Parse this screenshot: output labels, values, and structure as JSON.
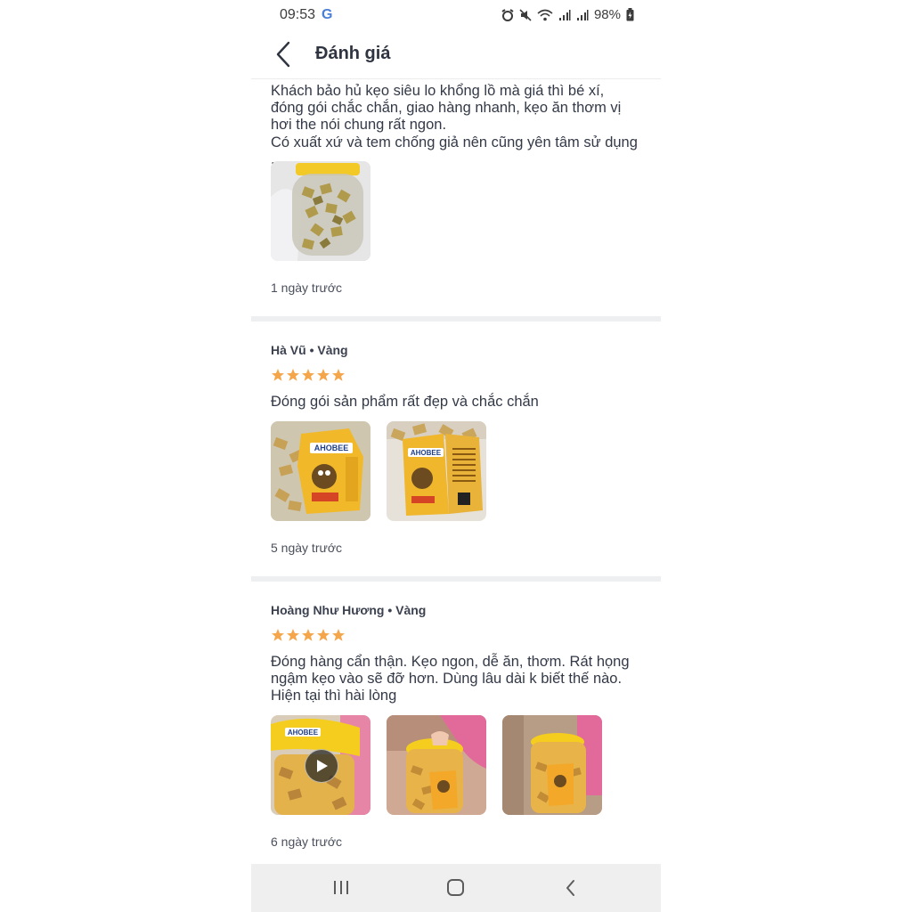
{
  "status_bar": {
    "time": "09:53",
    "google_icon": "G",
    "battery": "98%"
  },
  "header": {
    "title": "Đánh giá"
  },
  "reviews": [
    {
      "text": "Khách bảo hủ kẹo siêu lo khổng lồ mà giá thì bé xí,\nđóng gói chắc chắn, giao hàng nhanh, kẹo ăn thơm vị\nhơi the nói chung rất ngon.\nCó xuất xứ và tem chống giả nên cũng yên tâm sử dụng .",
      "time": "1 ngày trước"
    },
    {
      "author": "Hà Vũ • Vàng",
      "rating": 5,
      "text": "Đóng gói sản phẩm rất đẹp và chắc chắn",
      "time": "5 ngày trước",
      "photo_labels": [
        "AHOBEE",
        "AHOBEE"
      ]
    },
    {
      "author": "Hoàng Như Hương • Vàng",
      "rating": 5,
      "text": "Đóng hàng cẩn thận. Kẹo ngon, dễ ăn, thơm. Rát họng\nngậm kẹo vào sẽ đỡ hơn. Dùng lâu dài k biết thế nào.\nHiện tại thì hài lòng",
      "time": "6 ngày trước",
      "photo_labels": [
        "AHOBEE"
      ]
    }
  ],
  "colors": {
    "star": "#f5a54a",
    "divider": "#eeeff1",
    "nav_bg": "#efefef"
  }
}
